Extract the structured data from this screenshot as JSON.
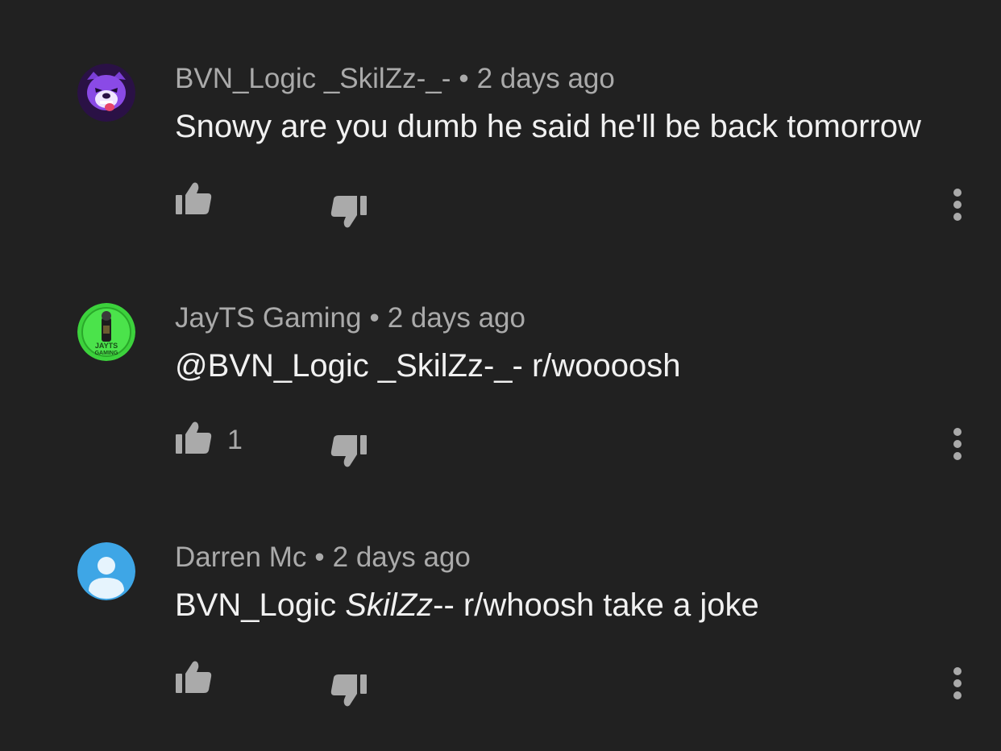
{
  "comments": [
    {
      "author": "BVN_Logic _SkilZz-_-",
      "separator": "•",
      "time": "2 days ago",
      "text": "Snowy are you dumb he said he'll be back tomorrow",
      "likes": "",
      "avatar_icon": "purple-bear-logo-icon"
    },
    {
      "author": "JayTS Gaming",
      "separator": "•",
      "time": "2 days ago",
      "text": "@BVN_Logic _SkilZz-_- r/woooosh",
      "likes": "1",
      "avatar_icon": "jayts-gaming-logo-icon",
      "avatar_text_line1": "JAYTS",
      "avatar_text_line2": "GAMING"
    },
    {
      "author": "Darren Mc",
      "separator": "•",
      "time": "2 days ago",
      "text_plain_1": "BVN_Logic ",
      "text_italic": "SkilZz",
      "text_plain_2": "-- r/whoosh take a joke",
      "likes": "",
      "avatar_icon": "default-user-icon"
    }
  ],
  "colors": {
    "background": "#212121",
    "meta_text": "#aaaaaa",
    "body_text": "#f1f1f1",
    "default_avatar_bg": "#3ea6e6"
  }
}
